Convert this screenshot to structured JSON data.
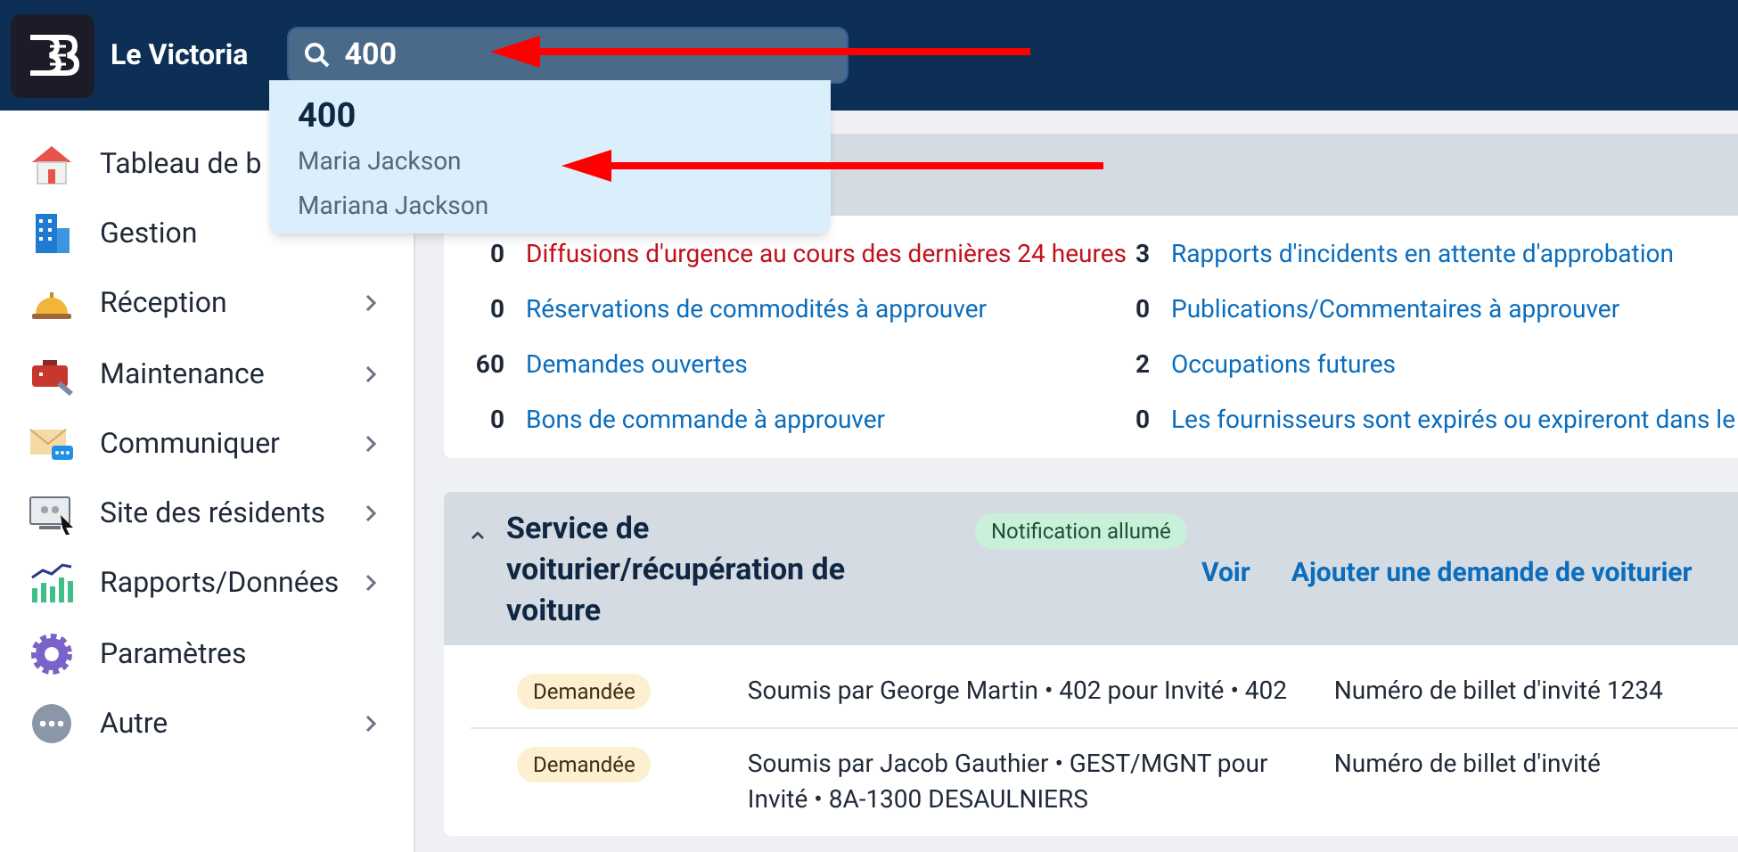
{
  "header": {
    "app_name": "Le Victoria",
    "search": {
      "value": "400"
    }
  },
  "search_results": [
    {
      "kind": "query",
      "text": "400"
    },
    {
      "kind": "person",
      "text": "Maria Jackson"
    },
    {
      "kind": "person",
      "text": "Mariana Jackson"
    }
  ],
  "sidebar": {
    "items": [
      {
        "kind": "home",
        "label": "Tableau de b"
      },
      {
        "kind": "building",
        "label": "Gestion",
        "expandable": false
      },
      {
        "kind": "bell",
        "label": "Réception",
        "expandable": true
      },
      {
        "kind": "toolbox",
        "label": "Maintenance",
        "expandable": true
      },
      {
        "kind": "mail",
        "label": "Communiquer",
        "expandable": true
      },
      {
        "kind": "monitor",
        "label": "Site des résidents",
        "expandable": true
      },
      {
        "kind": "chart",
        "label": "Rapports/Données",
        "expandable": true
      },
      {
        "kind": "gear",
        "label": "Paramètres",
        "expandable": false
      },
      {
        "kind": "more",
        "label": "Autre",
        "expandable": true
      }
    ]
  },
  "summary": {
    "items": [
      {
        "count": "0",
        "label": "Diffusions d'urgence au cours des dernières 24 heures",
        "alert": true
      },
      {
        "count": "3",
        "label": "Rapports d'incidents en attente d'approbation",
        "alert": false
      },
      {
        "count": "0",
        "label": "Réservations de commodités à approuver",
        "alert": false
      },
      {
        "count": "0",
        "label": "Publications/Commentaires à approuver",
        "alert": false
      },
      {
        "count": "60",
        "label": "Demandes ouvertes",
        "alert": false
      },
      {
        "count": "2",
        "label": "Occupations futures",
        "alert": false
      },
      {
        "count": "0",
        "label": "Bons de commande à approuver",
        "alert": false
      },
      {
        "count": "0",
        "label": "Les fournisseurs sont expirés ou expireront dans le",
        "alert": false
      }
    ]
  },
  "valet": {
    "title": "Service de voiturier/récupération de voiture",
    "expanded": true,
    "badge": "Notification allumé",
    "links": [
      "Voir",
      "Ajouter une demande de voiturier"
    ],
    "rows": [
      {
        "status": "Demandée",
        "description": "Soumis par George Martin • 402 pour Invité • 402",
        "ticket": "Numéro de billet d'invité 1234"
      },
      {
        "status": "Demandée",
        "description": "Soumis par Jacob Gauthier • GEST/MGNT pour Invité • 8A-1300 DESAULNIERS",
        "ticket": "Numéro de billet d'invité"
      }
    ]
  },
  "annotations": [
    {
      "kind": "arrow"
    },
    {
      "kind": "arrow"
    }
  ]
}
